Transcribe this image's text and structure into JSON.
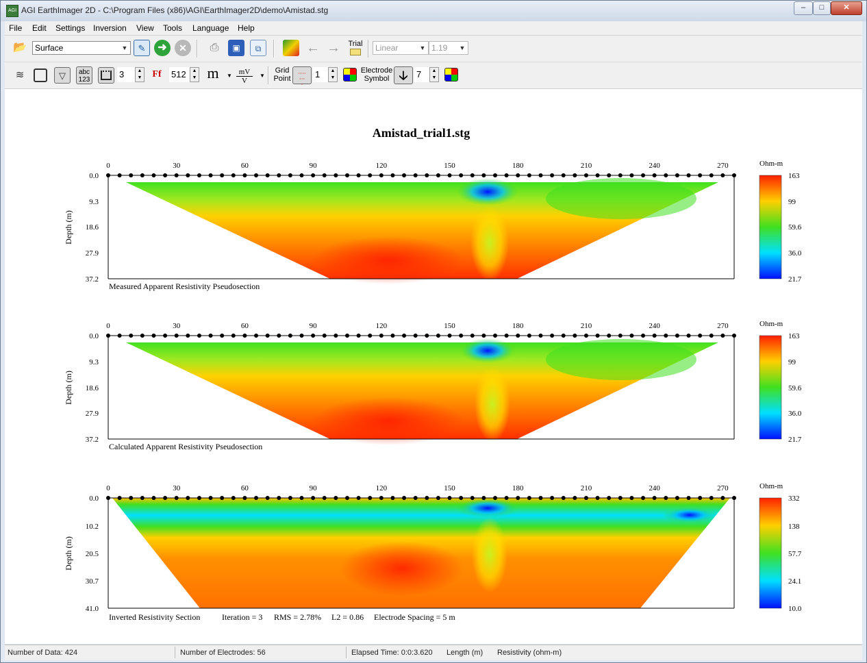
{
  "window": {
    "title": "AGI EarthImager 2D - C:\\Program Files (x86)\\AGI\\EarthImager2D\\demo\\Amistad.stg",
    "icon_text": "AGI"
  },
  "menu": [
    "File",
    "Edit",
    "Settings",
    "Inversion",
    "View",
    "Tools",
    "Language",
    "Help"
  ],
  "toolbar1": {
    "survey_type": "Surface",
    "trial_label": "Trial",
    "scale_type": "Linear",
    "scale_value": "1.19"
  },
  "toolbar2": {
    "abc_label": "abc",
    "num_label": "123",
    "font_letters": "Ff",
    "spin1_value": "3",
    "resolution": "512",
    "unit_m": "m",
    "unit_mv_top": "mV",
    "unit_mv_bot": "V",
    "grid_point_label_1": "Grid",
    "grid_point_label_2": "Point",
    "grid_point_value": "1",
    "electrode_symbol_label_1": "Electrode",
    "electrode_symbol_label_2": "Symbol",
    "electrode_symbol_value": "7"
  },
  "plot": {
    "title": "Amistad_trial1.stg",
    "x_ticks": [
      "0",
      "30",
      "60",
      "90",
      "120",
      "150",
      "180",
      "210",
      "240",
      "270"
    ],
    "panels": [
      {
        "name": "Measured Apparent Resistivity Pseudosection",
        "caption": "Measured Apparent Resistivity Pseudosection",
        "ylabel": "Depth (m)",
        "y_ticks": [
          "0.0",
          "9.3",
          "18.6",
          "27.9",
          "37.2"
        ],
        "cb_unit": "Ohm-m",
        "cb_ticks": [
          "163",
          "99",
          "59.6",
          "36.0",
          "21.7"
        ]
      },
      {
        "name": "Calculated Apparent Resistivity Pseudosection",
        "caption": "Calculated Apparent Resistivity Pseudosection",
        "ylabel": "Depth (m)",
        "y_ticks": [
          "0.0",
          "9.3",
          "18.6",
          "27.9",
          "37.2"
        ],
        "cb_unit": "Ohm-m",
        "cb_ticks": [
          "163",
          "99",
          "59.6",
          "36.0",
          "21.7"
        ]
      },
      {
        "name": "Inverted Resistivity Section",
        "caption": "Inverted Resistivity Section",
        "stats": [
          "Iteration = 3",
          "RMS = 2.78%",
          "L2 = 0.86",
          "Electrode Spacing = 5 m"
        ],
        "ylabel": "Depth (m)",
        "y_ticks": [
          "0.0",
          "10.2",
          "20.5",
          "30.7",
          "41.0"
        ],
        "cb_unit": "Ohm-m",
        "cb_ticks": [
          "332",
          "138",
          "57.7",
          "24.1",
          "10.0"
        ]
      }
    ],
    "colors": {
      "high": "#ff2000",
      "mid_high": "#ffd000",
      "mid": "#40e020",
      "mid_low": "#00e0ff",
      "low": "#0010ff"
    }
  },
  "status": {
    "data_count": "Number of Data: 424",
    "electrodes": "Number of Electrodes: 56",
    "elapsed": "Elapsed Time:  0:0:3.620",
    "length": "Length (m)",
    "resistivity": "Resistivity (ohm-m)"
  }
}
